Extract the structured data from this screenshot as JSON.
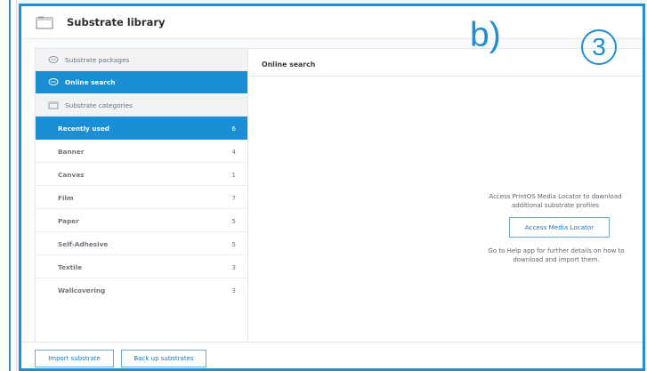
{
  "window": {
    "title": "Substrate library"
  },
  "overlay": {
    "label": "b)",
    "step": "3"
  },
  "sidebar": {
    "packages_label": "Substrate packages",
    "online_label": "Online search",
    "categories_label": "Substrate categories",
    "categories": [
      {
        "label": "Recently used",
        "count": "6"
      },
      {
        "label": "Banner",
        "count": "4"
      },
      {
        "label": "Canvas",
        "count": "1"
      },
      {
        "label": "Film",
        "count": "7"
      },
      {
        "label": "Paper",
        "count": "5"
      },
      {
        "label": "Self-Adhesive",
        "count": "5"
      },
      {
        "label": "Textile",
        "count": "3"
      },
      {
        "label": "Wallcovering",
        "count": "3"
      }
    ]
  },
  "content": {
    "title": "Online search",
    "info_line1": "Access PrintOS Media Locator to download",
    "info_line2": "additional substrate profiles",
    "access_button": "Access Media Locator",
    "help_line1": "Go to Help app for further details on how to",
    "help_line2": "download and import them."
  },
  "footer": {
    "import_label": "Import substrate",
    "backup_label": "Back up substrates"
  },
  "colors": {
    "accent": "#1a8fd5",
    "frame": "#1e8fd5"
  },
  "icons": {
    "title": "window-icon",
    "packages": "package-icon",
    "online": "cloud-search-icon",
    "categories": "folder-icon"
  }
}
